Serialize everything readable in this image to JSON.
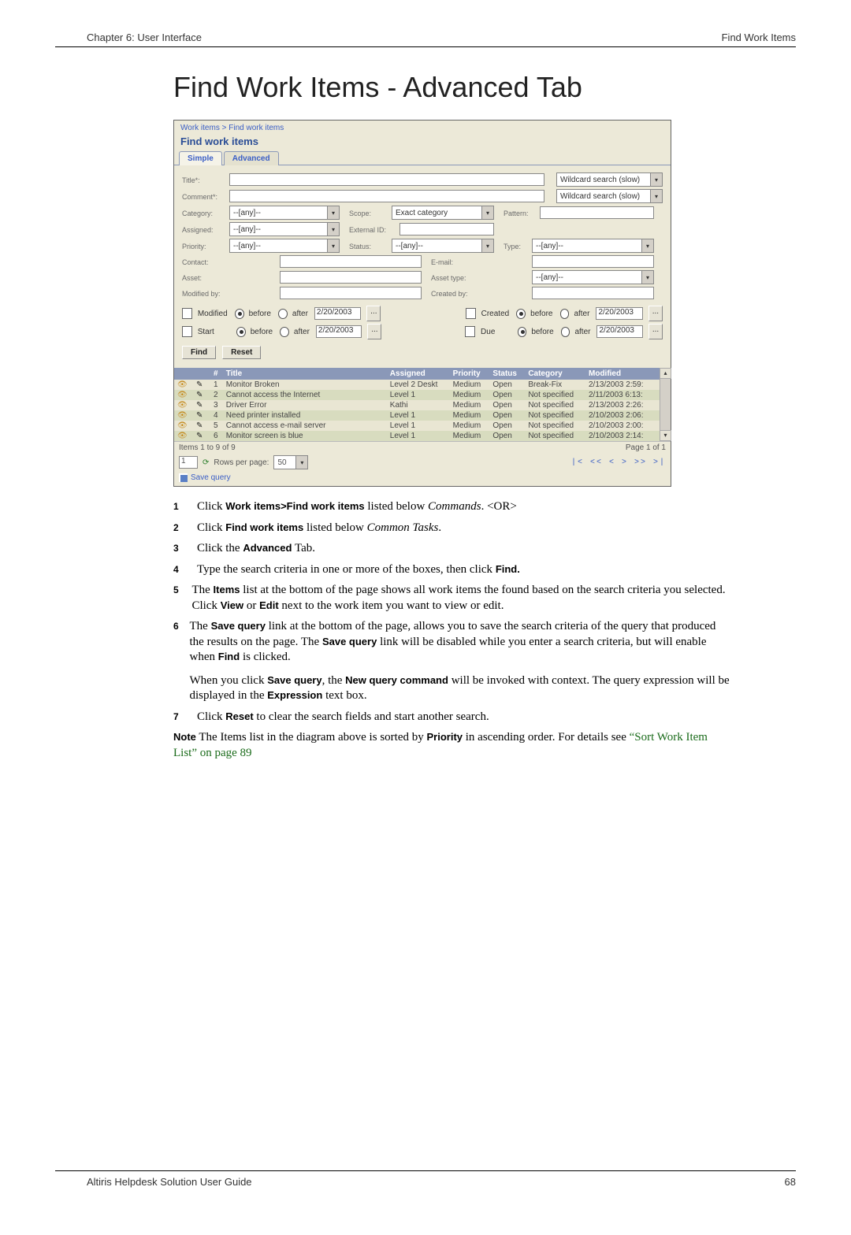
{
  "header": {
    "left": "Chapter 6: User Interface",
    "right": "Find Work Items"
  },
  "pageTitle": "Find Work Items - Advanced Tab",
  "breadcrumb": {
    "a": "Work items",
    "sep": " > ",
    "b": "Find work items"
  },
  "screenTitle": "Find work items",
  "tabs": {
    "simple": "Simple",
    "advanced": "Advanced"
  },
  "form": {
    "titleLabel": "Title*:",
    "commentLabel": "Comment*:",
    "wildcard": "Wildcard search (slow)",
    "categoryLabel": "Category:",
    "scopeLabel": "Scope:",
    "patternLabel": "Pattern:",
    "assignedLabel": "Assigned:",
    "externalIdLabel": "External ID:",
    "priorityLabel": "Priority:",
    "statusLabel": "Status:",
    "typeLabel": "Type:",
    "contactLabel": "Contact:",
    "emailLabel": "E‑mail:",
    "assetLabel": "Asset:",
    "assetTypeLabel": "Asset type:",
    "modifiedByLabel": "Modified by:",
    "createdByLabel": "Created by:",
    "anyOption": "--[any]--",
    "exactCategory": "Exact category",
    "modifiedCheck": "Modified",
    "startCheck": "Start",
    "createdCheck": "Created",
    "dueCheck": "Due",
    "before": "before",
    "after": "after",
    "date": "2/20/2003",
    "dots": "...",
    "findBtn": "Find",
    "resetBtn": "Reset"
  },
  "table": {
    "headers": {
      "num": "#",
      "title": "Title",
      "assigned": "Assigned",
      "priority": "Priority",
      "status": "Status",
      "category": "Category",
      "modified": "Modified"
    },
    "rows": [
      {
        "n": "1",
        "title": "Monitor Broken",
        "assigned": "Level 2 Deskt",
        "priority": "Medium",
        "status": "Open",
        "category": "Break‑Fix",
        "modified": "2/13/2003 2:59:"
      },
      {
        "n": "2",
        "title": "Cannot access the Internet",
        "assigned": "Level 1",
        "priority": "Medium",
        "status": "Open",
        "category": "Not specified",
        "modified": "2/11/2003 6:13:"
      },
      {
        "n": "3",
        "title": "Driver Error",
        "assigned": "Kathi",
        "priority": "Medium",
        "status": "Open",
        "category": "Not specified",
        "modified": "2/13/2003 2:26:"
      },
      {
        "n": "4",
        "title": "Need printer installed",
        "assigned": "Level 1",
        "priority": "Medium",
        "status": "Open",
        "category": "Not specified",
        "modified": "2/10/2003 2:06:"
      },
      {
        "n": "5",
        "title": "Cannot access e‑mail server",
        "assigned": "Level 1",
        "priority": "Medium",
        "status": "Open",
        "category": "Not specified",
        "modified": "2/10/2003 2:00:"
      },
      {
        "n": "6",
        "title": "Monitor screen is blue",
        "assigned": "Level 1",
        "priority": "Medium",
        "status": "Open",
        "category": "Not specified",
        "modified": "2/10/2003 2:14:"
      }
    ]
  },
  "statusBar": {
    "itemsText": "Items 1 to 9 of 9",
    "pageText": "Page 1 of 1",
    "pageInput": "1",
    "rowsLabel": "Rows per page:",
    "rowsValue": "50",
    "pager": "|<  <<  <  >  >>  >|"
  },
  "saveQuery": "Save query",
  "instructions": {
    "s1a": "Click ",
    "s1b": "Work items>Find work items",
    "s1c": " listed below ",
    "s1d": "Commands",
    "s1e": ". <OR>",
    "s2a": "Click ",
    "s2b": "Find work items",
    "s2c": " listed below ",
    "s2d": "Common Tasks",
    "s2e": ".",
    "s3a": "Click the ",
    "s3b": "Advanced",
    "s3c": " Tab.",
    "s4a": "Type the search criteria in one or more of the boxes, then click ",
    "s4b": "Find.",
    "s5a": "The ",
    "s5b": "Items",
    "s5c": " list at the bottom of the page shows all work items the found based on the search criteria you selected. Click ",
    "s5d": "View",
    "s5e": " or ",
    "s5f": "Edit",
    "s5g": " next to the work item you want to view or edit.",
    "s6a": "The ",
    "s6b": "Save query",
    "s6c": " link at the bottom of the page, allows you to save the search criteria of the query that produced the results on the page. The ",
    "s6d": "Save query",
    "s6e": " link will be disabled while you enter a search criteria, but will enable when ",
    "s6f": "Find",
    "s6g": " is clicked.",
    "s6p2a": "When you click ",
    "s6p2b": "Save query",
    "s6p2c": ", the ",
    "s6p2d": "New query command",
    "s6p2e": " will be invoked with context. The query expression will be displayed in the ",
    "s6p2f": "Expression",
    "s6p2g": " text box.",
    "s7a": "Click ",
    "s7b": "Reset",
    "s7c": " to clear the search fields and start another search.",
    "noteA": "Note",
    "noteB": " The Items list in the diagram above is sorted by ",
    "noteC": "Priority",
    "noteD": " in ascending order. For details see ",
    "noteE": "“Sort Work Item List” on page 89"
  },
  "nums": {
    "n1": "1",
    "n2": "2",
    "n3": "3",
    "n4": "4",
    "n5": "5",
    "n6": "6",
    "n7": "7"
  },
  "footer": {
    "left": "Altiris Helpdesk Solution User Guide",
    "right": "68"
  }
}
